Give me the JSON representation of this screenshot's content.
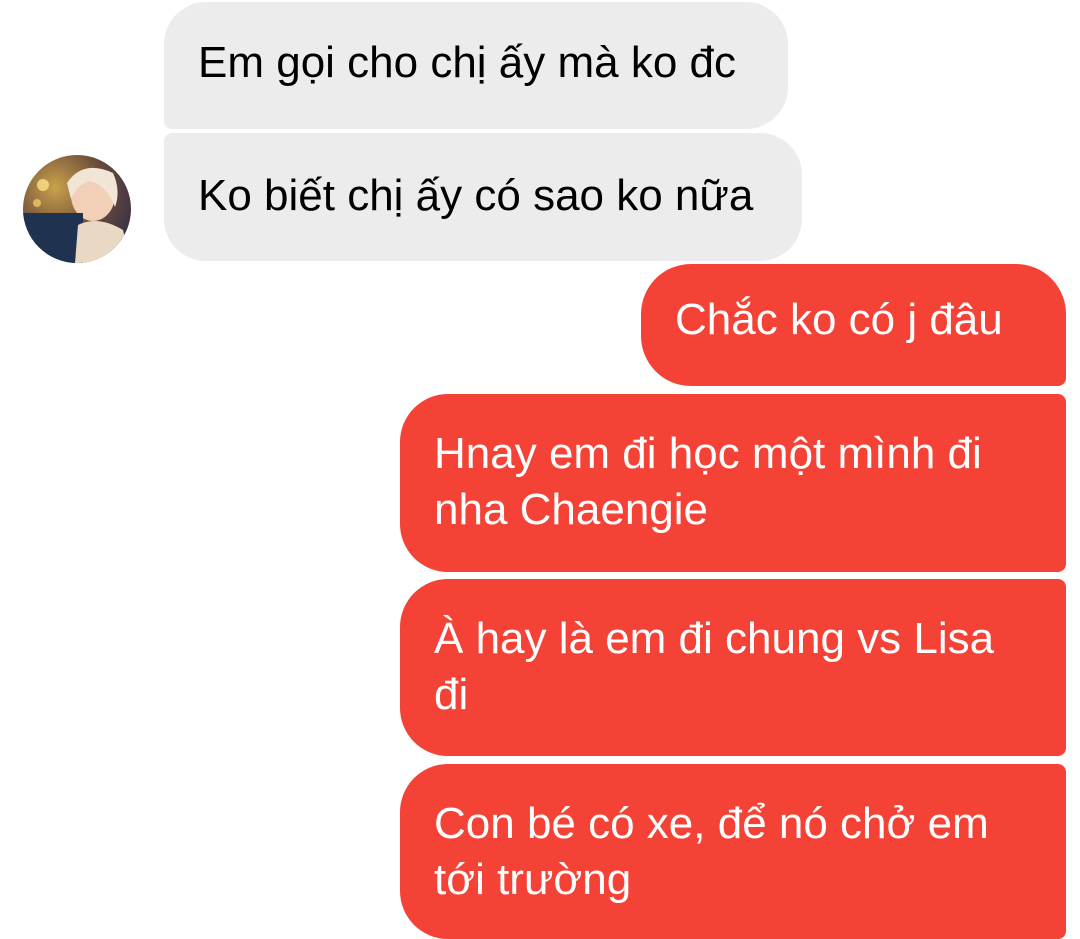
{
  "conversation": {
    "incoming": [
      {
        "text": "Em gọi cho chị ấy mà ko đc"
      },
      {
        "text": "Ko biết chị ấy có sao ko nữa"
      }
    ],
    "outgoing": [
      {
        "text": "Chắc ko có j đâu"
      },
      {
        "text": "Hnay em đi học một mình đi nha Chaengie"
      },
      {
        "text": "À hay là em đi chung vs Lisa đi"
      },
      {
        "text": "Con bé có xe, để nó chở em tới trường"
      }
    ]
  },
  "colors": {
    "incoming_bubble": "#ececec",
    "outgoing_bubble": "#f44336",
    "incoming_text": "#000000",
    "outgoing_text": "#ffffff"
  },
  "avatar": {
    "icon": "contact-avatar-photo"
  }
}
